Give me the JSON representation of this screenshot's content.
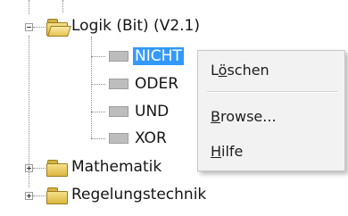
{
  "tree": {
    "logik": {
      "label": "Logik (Bit) (V2.1)",
      "expanded": true,
      "children": [
        {
          "label": "NICHT",
          "selected": true
        },
        {
          "label": "ODER",
          "selected": false
        },
        {
          "label": "UND",
          "selected": false
        },
        {
          "label": "XOR",
          "selected": false
        }
      ]
    },
    "mathematik": {
      "label": "Mathematik",
      "expanded": false
    },
    "regelungstechnik": {
      "label": "Regelungstechnik",
      "expanded": false
    }
  },
  "context_menu": {
    "items": [
      {
        "prefix": "L",
        "accel": "ö",
        "suffix": "schen"
      },
      {
        "prefix": "",
        "accel": "B",
        "suffix": "rowse..."
      },
      {
        "prefix": "",
        "accel": "H",
        "suffix": "ilfe"
      }
    ]
  },
  "colors": {
    "selection": "#3399ff",
    "menu_background": "#f2f2f2",
    "folder": "#f0cf5a"
  },
  "icons": {
    "collapse": "minus-box-icon",
    "expand": "plus-box-icon",
    "folder_open": "folder-open-icon",
    "folder_closed": "folder-icon",
    "item": "block-icon"
  }
}
